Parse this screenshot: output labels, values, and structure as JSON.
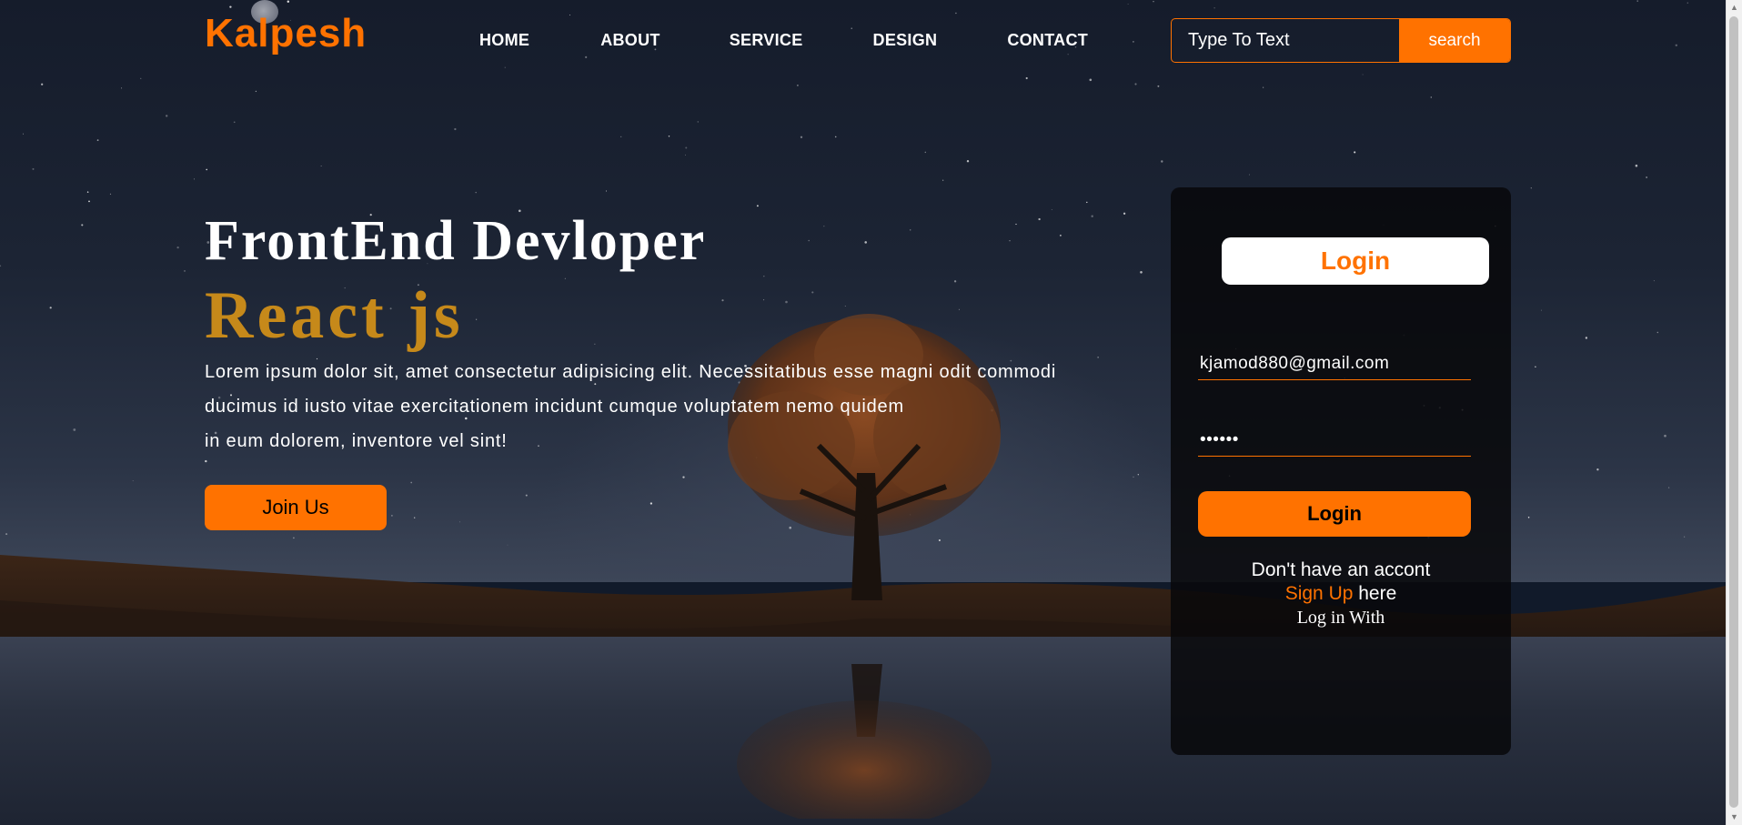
{
  "header": {
    "logo": "Kalpesh",
    "nav": [
      "HOME",
      "ABOUT",
      "SERVICE",
      "DESIGN",
      "CONTACT"
    ],
    "search": {
      "placeholder": "Type To Text",
      "button": "search"
    }
  },
  "hero": {
    "title": "FrontEnd Devloper",
    "subtitle": "React js",
    "text_lines": [
      "Lorem ipsum dolor sit, amet consectetur adipisicing elit. Necessitatibus esse magni odit commodi",
      "ducimus id iusto vitae exercitationem incidunt cumque voluptatem nemo quidem",
      "in eum dolorem, inventore vel sint!"
    ],
    "cta": "Join Us"
  },
  "login": {
    "heading": "Login",
    "email_value": "kjamod880@gmail.com",
    "password_value": "••••••",
    "button": "Login",
    "no_account": "Don't have an accont",
    "signup_link": "Sign Up",
    "signup_suffix": " here",
    "login_with": "Log in With"
  },
  "colors": {
    "accent": "#ff7200",
    "subtitle_gold": "#c6891a",
    "card_bg": "#08080a"
  },
  "icons": [
    "moon-icon",
    "tree-illustration"
  ]
}
